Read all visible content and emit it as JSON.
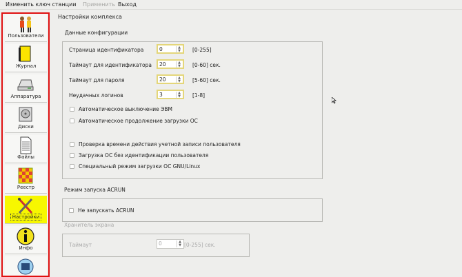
{
  "menu": {
    "change_key": "Изменить ключ станции",
    "apply": "Применить",
    "exit": "Выход"
  },
  "sidebar": {
    "items": [
      {
        "label": "Пользователи",
        "icon": "users-icon"
      },
      {
        "label": "Журнал",
        "icon": "journal-icon"
      },
      {
        "label": "Аппаратура",
        "icon": "hardware-icon"
      },
      {
        "label": "Диски",
        "icon": "disks-icon"
      },
      {
        "label": "Файлы",
        "icon": "files-icon"
      },
      {
        "label": "Реестр",
        "icon": "registry-icon"
      },
      {
        "label": "Настройки",
        "icon": "settings-icon",
        "selected": true
      },
      {
        "label": "Инфо",
        "icon": "info-icon"
      }
    ]
  },
  "main": {
    "title": "Настройки комплекса",
    "config": {
      "heading": "Данные конфигурации",
      "fields": [
        {
          "label": "Страница идентификатора",
          "value": "0",
          "range": "[0-255]"
        },
        {
          "label": "Таймаут для идентификатора",
          "value": "20",
          "range": "[0-60] сек."
        },
        {
          "label": "Таймаут для пароля",
          "value": "20",
          "range": "[5-60] сек."
        },
        {
          "label": "Неудачных логинов",
          "value": "3",
          "range": "[1-8]"
        }
      ],
      "checks": [
        "Автоматическое выключение ЭВМ",
        "Автоматическое продолжение загрузки ОС",
        "Проверка времени действия учетной записи пользователя",
        "Загрузка ОС без идентификации пользователя",
        "Специальный режим загрузки ОС GNU/Linux"
      ]
    },
    "acrun": {
      "heading": "Режим запуска ACRUN",
      "check": "Не запускать ACRUN"
    },
    "screensaver": {
      "heading": "Хранитель экрана",
      "label": "Таймаут",
      "value": "0",
      "range": "[0-255] сек."
    }
  }
}
